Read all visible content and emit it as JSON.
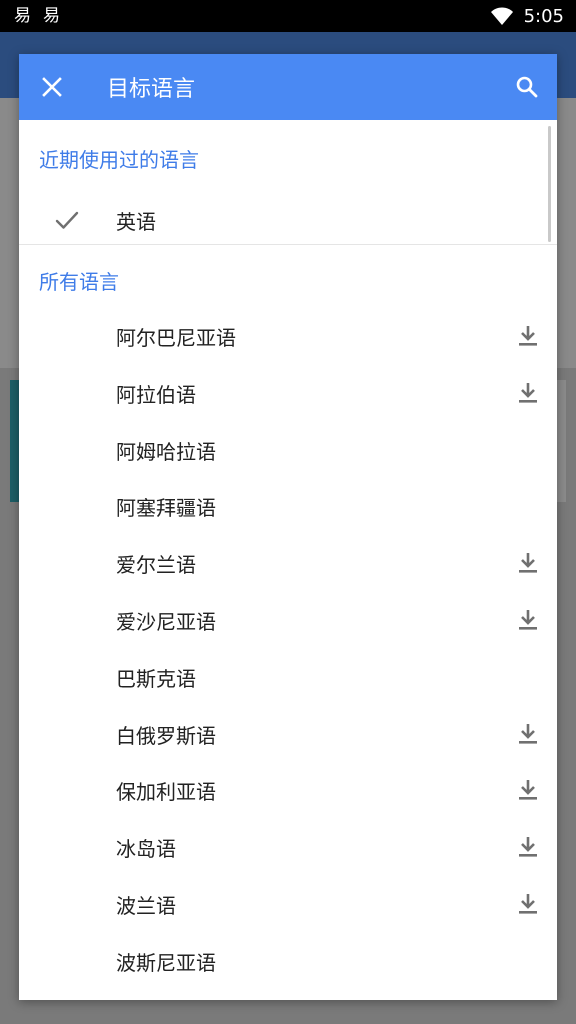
{
  "status_bar": {
    "time": "5:05",
    "notification_glyphs": [
      "易",
      "易"
    ]
  },
  "dialog": {
    "title": "目标语言",
    "close_icon": "close-icon",
    "search_icon": "search-icon",
    "recent_section_title": "近期使用过的语言",
    "recent_items": [
      {
        "label": "英语",
        "selected": true
      }
    ],
    "all_section_title": "所有语言",
    "languages": [
      {
        "label": "阿尔巴尼亚语",
        "downloadable": true
      },
      {
        "label": "阿拉伯语",
        "downloadable": true
      },
      {
        "label": "阿姆哈拉语",
        "downloadable": false
      },
      {
        "label": "阿塞拜疆语",
        "downloadable": false
      },
      {
        "label": "爱尔兰语",
        "downloadable": true
      },
      {
        "label": "爱沙尼亚语",
        "downloadable": true
      },
      {
        "label": "巴斯克语",
        "downloadable": false
      },
      {
        "label": "白俄罗斯语",
        "downloadable": true
      },
      {
        "label": "保加利亚语",
        "downloadable": true
      },
      {
        "label": "冰岛语",
        "downloadable": true
      },
      {
        "label": "波兰语",
        "downloadable": true
      },
      {
        "label": "波斯尼亚语",
        "downloadable": false
      }
    ]
  },
  "colors": {
    "header": "#4a89f3",
    "section_title": "#3f7ce8",
    "text": "#222222",
    "icon_gray": "#707070"
  }
}
